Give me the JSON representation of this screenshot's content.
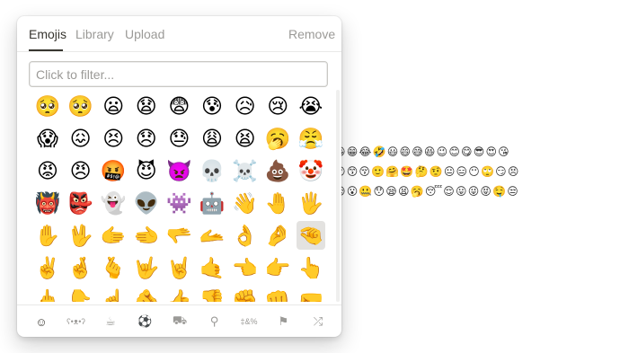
{
  "tabs": {
    "emojis": "Emojis",
    "library": "Library",
    "upload": "Upload",
    "remove": "Remove"
  },
  "filter": {
    "placeholder": "Click to filter..."
  },
  "emoji_grid": [
    [
      "🥺",
      "🥺",
      "😦",
      "😧",
      "😨",
      "😰",
      "😥",
      "😢",
      "😭"
    ],
    [
      "😱",
      "😖",
      "😣",
      "😞",
      "😓",
      "😩",
      "😫",
      "🥱",
      "😤"
    ],
    [
      "😡",
      "😠",
      "🤬",
      "😈",
      "👿",
      "💀",
      "☠️",
      "💩",
      "🤡"
    ],
    [
      "👹",
      "👺",
      "👻",
      "👽",
      "👾",
      "🤖",
      "👋",
      "🤚",
      "🖐️"
    ],
    [
      "✋",
      "🖖",
      "🫱",
      "🫲",
      "🫳",
      "🫴",
      "👌",
      "🤌",
      "🤏"
    ],
    [
      "✌️",
      "🤞",
      "🫰",
      "🤟",
      "🤘",
      "🤙",
      "👈",
      "👉",
      "👆"
    ],
    [
      "🖕",
      "👇",
      "☝️",
      "🫵",
      "👍",
      "👎",
      "✊",
      "👊",
      "🤛"
    ]
  ],
  "selected_emoji": {
    "row": 4,
    "col": 8
  },
  "background_emoji_rows": [
    "😀😁😂🤣😃😄😅😆😉😊😋😎😍😘",
    "😗😙😚🙂🤗🤩🤔🤨😐😑😶🙄😏😣",
    "😥😮🤐😯😪😫🥱😴😌😛😜😝🤤😒"
  ],
  "categories": [
    {
      "name": "smileys-icon",
      "glyph": "☺"
    },
    {
      "name": "animals-icon",
      "glyph": "ʕ•ᴥ•ʔ"
    },
    {
      "name": "food-icon",
      "glyph": "☕"
    },
    {
      "name": "activity-icon",
      "glyph": "⚽"
    },
    {
      "name": "travel-icon",
      "glyph": "⛟"
    },
    {
      "name": "objects-icon",
      "glyph": "⚲"
    },
    {
      "name": "symbols-icon",
      "glyph": "‡&%"
    },
    {
      "name": "flags-icon",
      "glyph": "⚑"
    },
    {
      "name": "random-icon",
      "glyph": "⤮"
    }
  ],
  "active_category": 0
}
